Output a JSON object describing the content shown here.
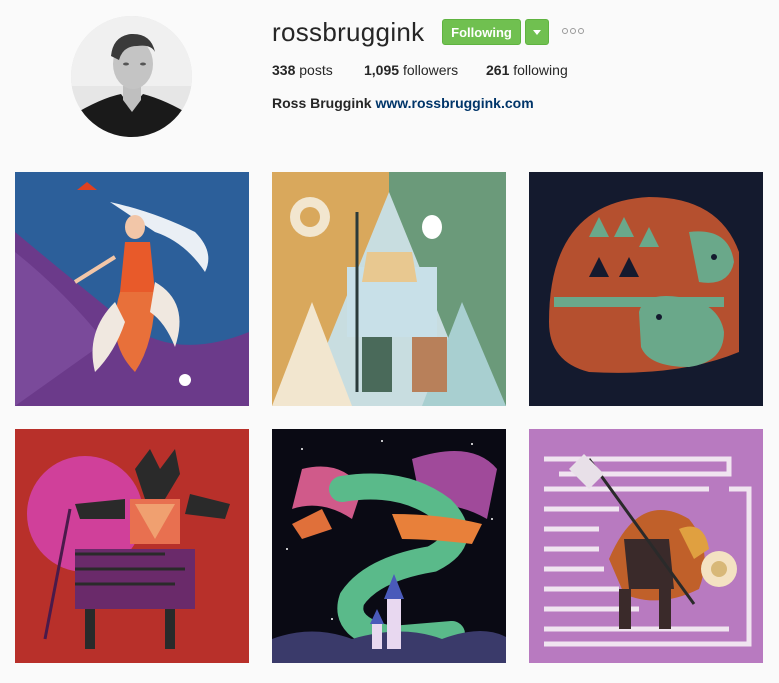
{
  "profile": {
    "username": "rossbruggink",
    "follow_label": "Following",
    "stats": {
      "posts_count": "338",
      "posts_label": "posts",
      "followers_count": "1,095",
      "followers_label": "followers",
      "following_count": "261",
      "following_label": "following"
    },
    "full_name": "Ross Bruggink",
    "website": "www.rossbruggink.com"
  },
  "colors": {
    "follow_green": "#70c050",
    "link_blue": "#003569",
    "text": "#262626",
    "background": "#fafafa"
  },
  "icons": {
    "dropdown": "chevron-down-icon",
    "more": "ellipsis-icon"
  }
}
